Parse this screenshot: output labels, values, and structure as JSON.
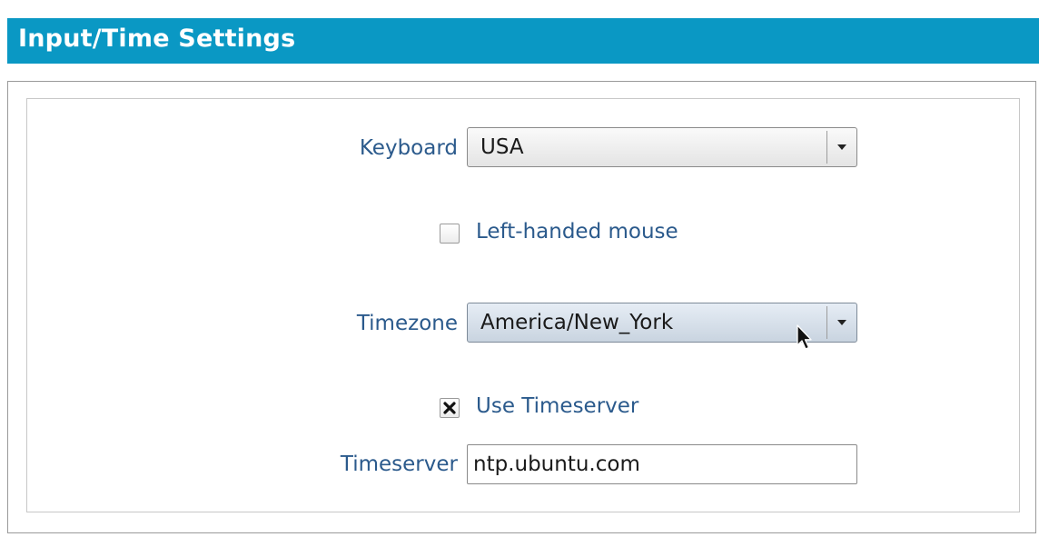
{
  "header": {
    "title": "Input/Time Settings"
  },
  "form": {
    "keyboard": {
      "label": "Keyboard",
      "selected": "USA"
    },
    "left_handed_mouse": {
      "label": "Left-handed mouse",
      "checked": false
    },
    "timezone": {
      "label": "Timezone",
      "selected": "America/New_York"
    },
    "use_timeserver": {
      "label": "Use Timeserver",
      "checked": true
    },
    "timeserver": {
      "label": "Timeserver",
      "value": "ntp.ubuntu.com"
    }
  },
  "colors": {
    "title_bar": "#0a98c4",
    "label_text": "#2b5a8c"
  },
  "icons": {
    "dropdown": "chevron-down-icon",
    "checkbox_checked": "x-mark-icon",
    "cursor": "mouse-pointer-icon"
  }
}
